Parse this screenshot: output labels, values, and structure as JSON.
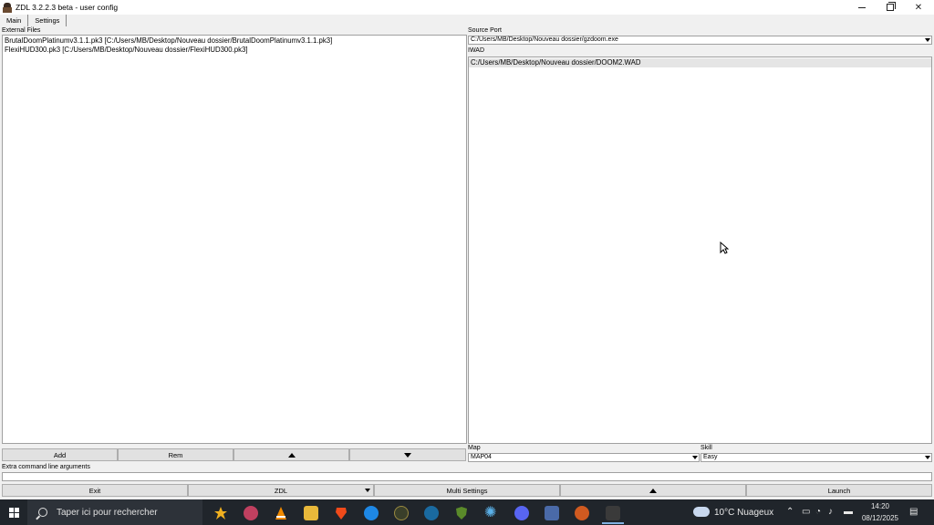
{
  "window": {
    "title": "ZDL 3.2.2.3 beta - user config"
  },
  "tabs": [
    {
      "label": "Main"
    },
    {
      "label": "Settings"
    }
  ],
  "main": {
    "external_files_label": "External Files",
    "external_files": [
      "BrutalDoomPlatinumv3.1.1.pk3 [C:/Users/MB/Desktop/Nouveau dossier/BrutalDoomPlatinumv3.1.1.pk3]",
      "FlexiHUD300.pk3 [C:/Users/MB/Desktop/Nouveau dossier/FlexiHUD300.pk3]"
    ],
    "add_label": "Add",
    "rem_label": "Rem",
    "source_port_label": "Source Port",
    "source_port_value": "C:/Users/MB/Desktop/Nouveau dossier/gzdoom.exe",
    "iwad_label": "IWAD",
    "iwads": [
      "C:/Users/MB/Desktop/Nouveau dossier/DOOM2.WAD"
    ],
    "map_label": "Map",
    "map_value": "MAP04",
    "skill_label": "Skill",
    "skill_value": "Easy",
    "extra_args_label": "Extra command line arguments"
  },
  "bottom": {
    "exit_label": "Exit",
    "zdl_label": "ZDL",
    "multi_label": "Multi Settings",
    "launch_label": "Launch"
  },
  "taskbar": {
    "search_placeholder": "Taper ici pour rechercher",
    "weather": "10°C Nuageux",
    "time": "14:20",
    "date": "08/12/2025"
  },
  "icons": {
    "app": "doom-marine-icon",
    "start": "windows-logo-icon"
  }
}
